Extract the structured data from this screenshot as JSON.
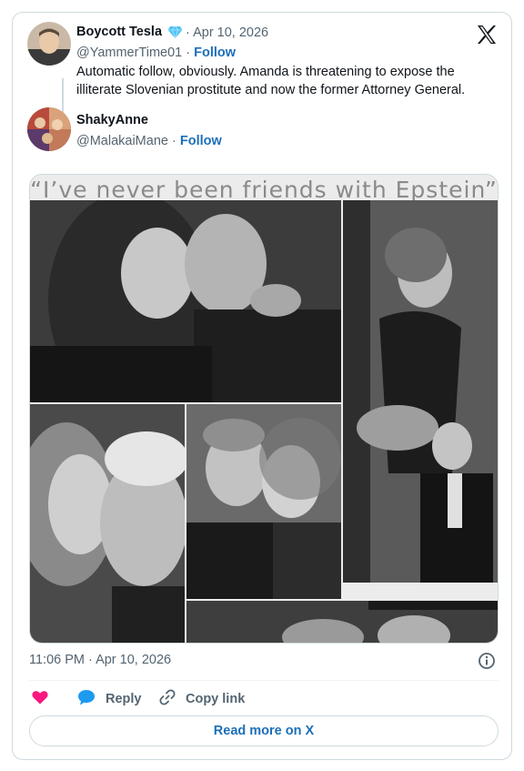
{
  "colors": {
    "link": "#1d6fb8",
    "muted": "#536471",
    "like": "#f91880",
    "reply": "#1d9bf0",
    "verified": "#4fc3f7"
  },
  "post": {
    "author_name": "Boycott Tesla",
    "badge_icon": "diamond-icon",
    "date": "Apr 10, 2026",
    "handle": "@YammerTime01",
    "follow_label": "Follow",
    "text": "Automatic follow, obviously. Amanda is threatening to expose the illiterate Slovenian prostitute and now the former Attorney General."
  },
  "quoted": {
    "author_name": "ShakyAnne",
    "handle": "@MalakaiMane",
    "follow_label": "Follow"
  },
  "media": {
    "caption": "“I’ve never been friends with Epstein”"
  },
  "footer": {
    "timestamp": "11:06 PM · Apr 10, 2026",
    "like_icon": "heart-icon",
    "reply_label": "Reply",
    "copy_label": "Copy link",
    "read_more_label": "Read more on X"
  },
  "separator": "·"
}
